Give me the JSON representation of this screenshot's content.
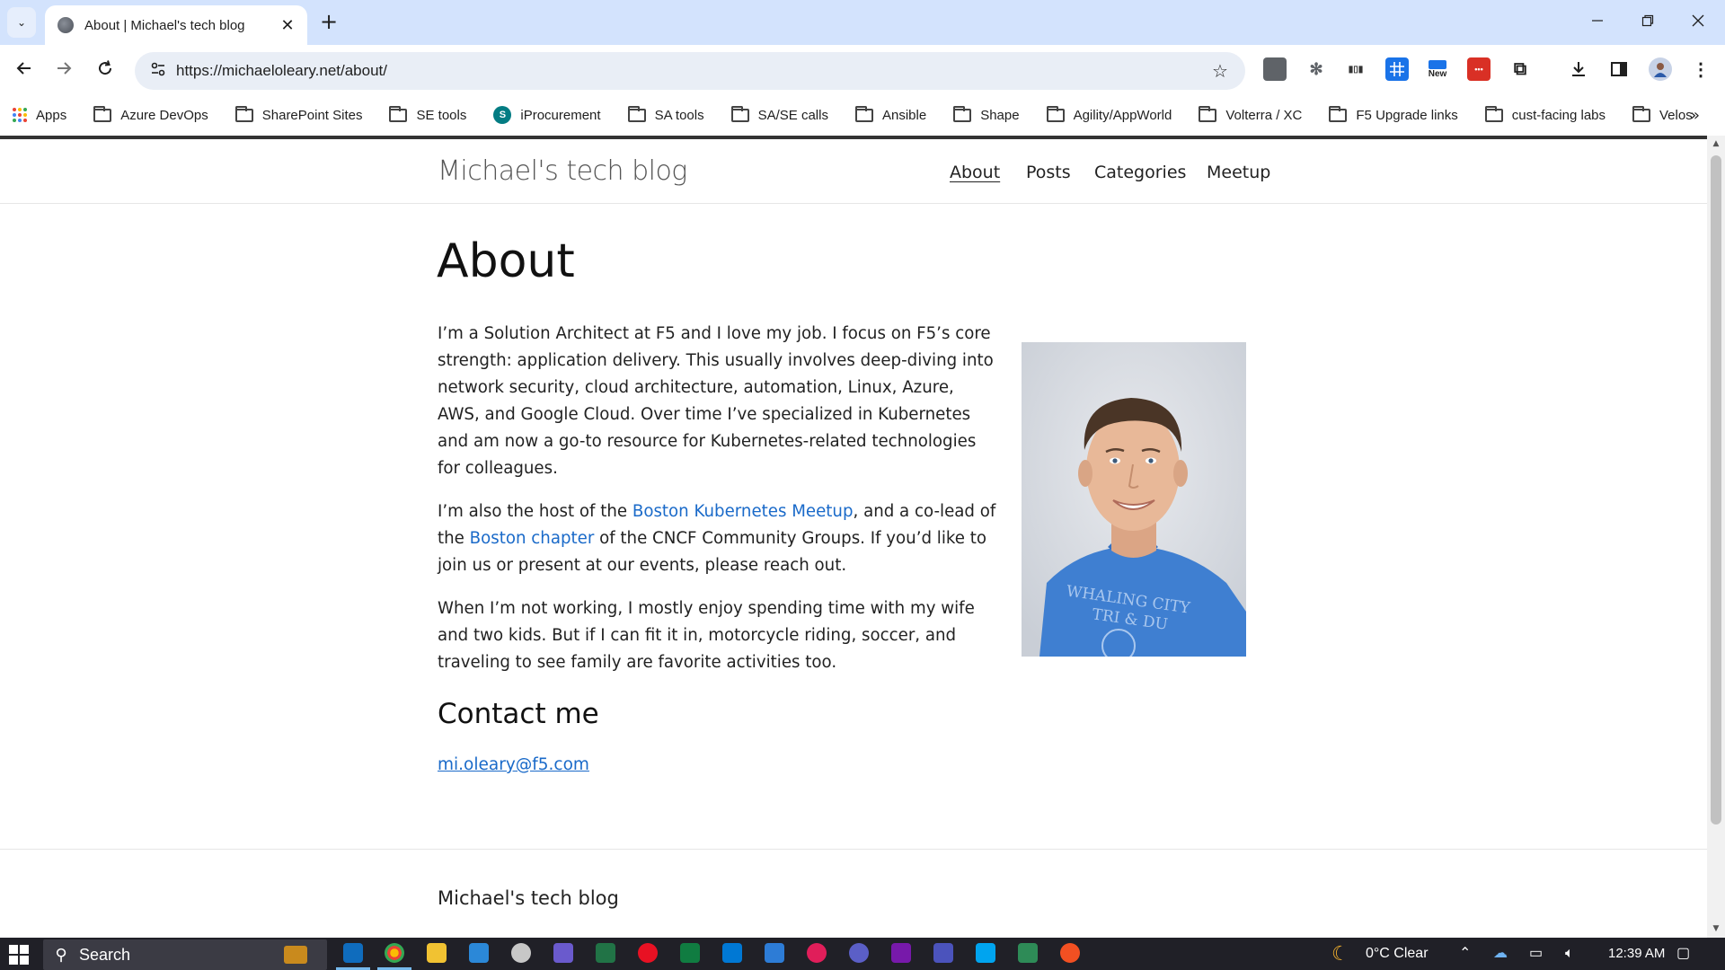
{
  "browser": {
    "tab_title": "About | Michael's tech blog",
    "tab_close": "✕",
    "new_tab": "+",
    "url": "https://michaeloleary.net/about/",
    "extensions": [
      {
        "name": "ext-1",
        "color": "#5f6368",
        "label": ""
      },
      {
        "name": "ext-2",
        "color": "#5f6368",
        "label": ""
      },
      {
        "name": "ext-3",
        "color": "#5f6368",
        "label": ""
      },
      {
        "name": "ext-4",
        "color": "#1a73e8",
        "label": ""
      },
      {
        "name": "ext-new",
        "color": "#1a73e8",
        "label": "New"
      },
      {
        "name": "ext-6",
        "color": "#d93025",
        "label": "•••"
      }
    ]
  },
  "bookmarks": {
    "items": [
      {
        "label": "Apps",
        "type": "apps"
      },
      {
        "label": "Azure DevOps",
        "type": "folder"
      },
      {
        "label": "SharePoint Sites",
        "type": "folder"
      },
      {
        "label": "SE tools",
        "type": "folder"
      },
      {
        "label": "iProcurement",
        "type": "sharepoint"
      },
      {
        "label": "SA tools",
        "type": "folder"
      },
      {
        "label": "SA/SE calls",
        "type": "folder"
      },
      {
        "label": "Ansible",
        "type": "folder"
      },
      {
        "label": "Shape",
        "type": "folder"
      },
      {
        "label": "Agility/AppWorld",
        "type": "folder"
      },
      {
        "label": "Volterra / XC",
        "type": "folder"
      },
      {
        "label": "F5 Upgrade links",
        "type": "folder"
      },
      {
        "label": "cust-facing labs",
        "type": "folder"
      },
      {
        "label": "Velos",
        "type": "folder"
      }
    ],
    "more": "»"
  },
  "site": {
    "title": "Michael's tech blog",
    "menu": [
      "About",
      "Posts",
      "Categories",
      "Meetup"
    ],
    "active_menu": "About"
  },
  "page": {
    "heading": "About",
    "p1": "I’m a Solution Architect at F5 and I love my job. I focus on F5’s core strength: application delivery. This usually involves deep-diving into network security, cloud architecture, automation, Linux, Azure, AWS, and Google Cloud. Over time I’ve specialized in Kubernetes and am now a go-to resource for Kubernetes-related technologies for colleagues.",
    "p2": {
      "t1": "I’m also the host of the ",
      "link1": "Boston Kubernetes Meetup",
      "t2": ", and a co-lead of the ",
      "link2": "Boston chapter",
      "t3": " of the CNCF Community Groups. If you’d like to join us or present at our events, please reach out."
    },
    "p3": "When I’m not working, I mostly enjoy spending time with my wife and two kids. But if I can fit it in, motorcycle riding, soccer, and traveling to see family are favorite activities too.",
    "contact_heading": "Contact me",
    "email": "mi.oleary@f5.com",
    "shirt_text_1": "WHALING CITY",
    "shirt_text_2": "TRI & DU"
  },
  "footer": {
    "title": "Michael's tech blog"
  },
  "taskbar": {
    "search_label": "Search",
    "weather": "0°C  Clear",
    "time": "12:39 AM"
  }
}
